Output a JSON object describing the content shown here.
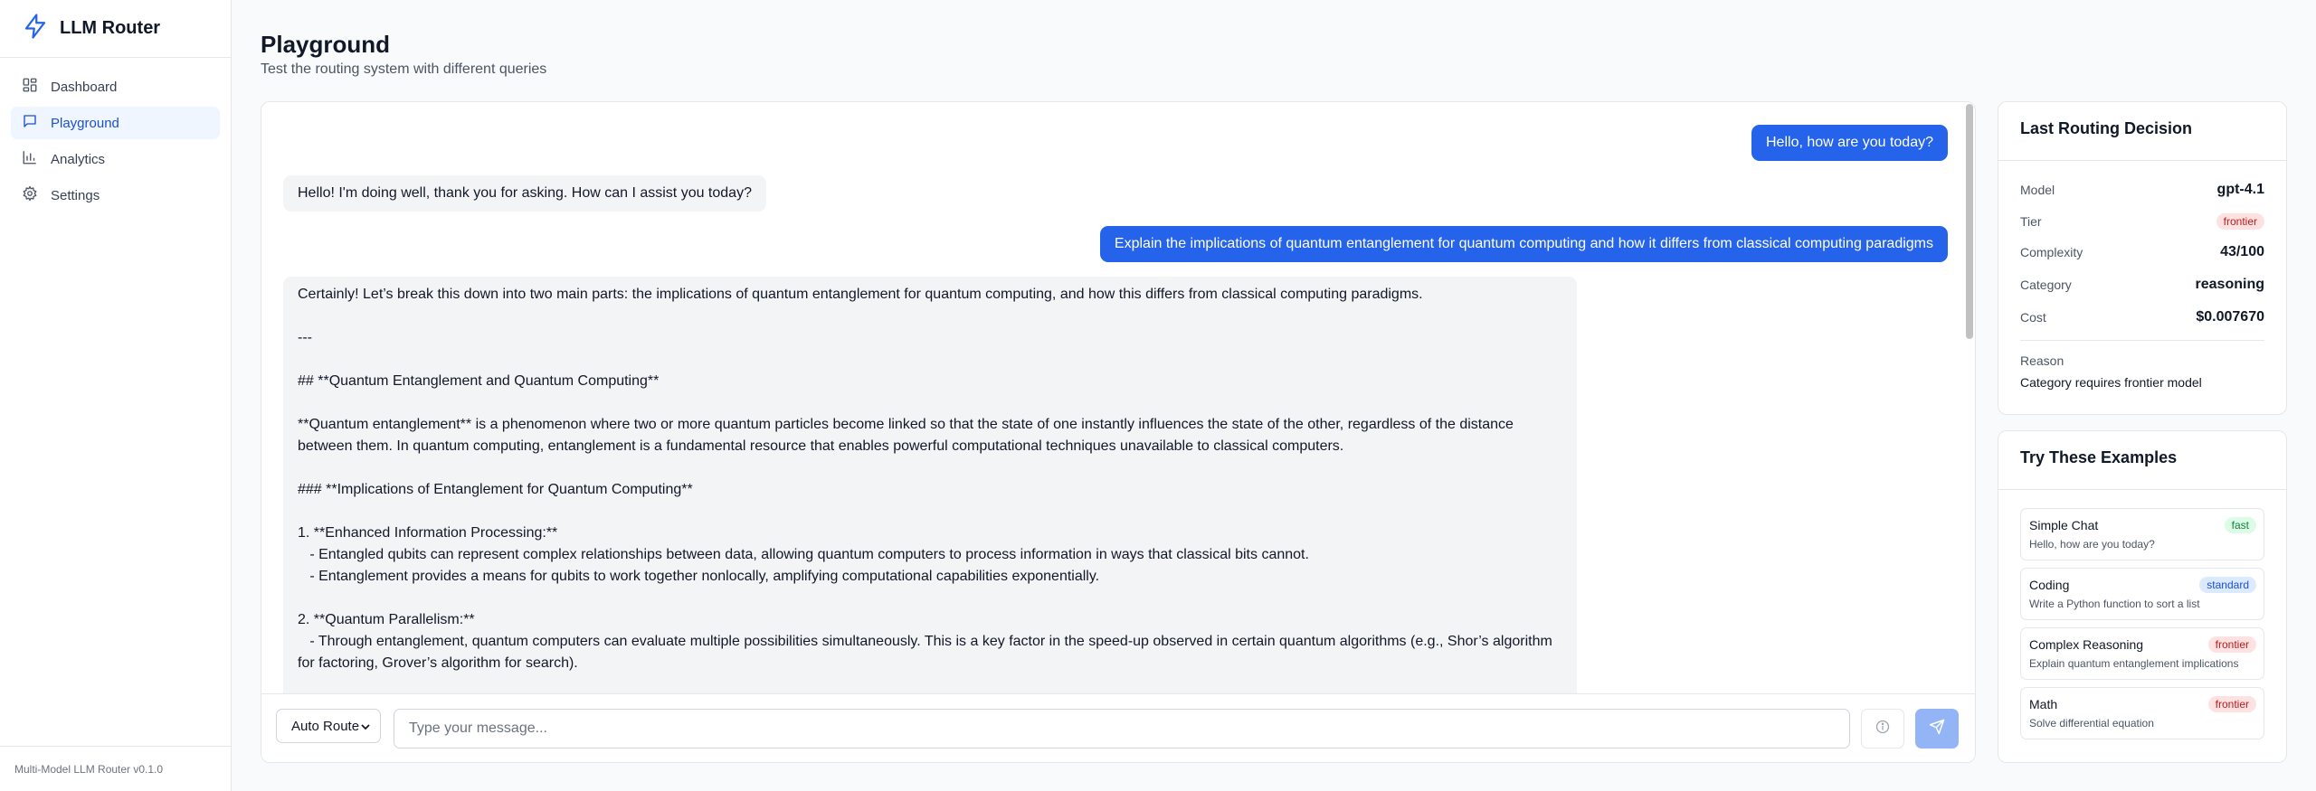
{
  "sidebar": {
    "brand": "LLM Router",
    "items": [
      {
        "label": "Dashboard",
        "icon": "dashboard-icon"
      },
      {
        "label": "Playground",
        "icon": "chat-icon",
        "active": true
      },
      {
        "label": "Analytics",
        "icon": "bar-chart-icon"
      },
      {
        "label": "Settings",
        "icon": "gear-icon"
      }
    ],
    "footer": "Multi-Model LLM Router v0.1.0"
  },
  "header": {
    "title": "Playground",
    "subtitle": "Test the routing system with different queries"
  },
  "chat": {
    "messages": [
      {
        "role": "user",
        "text": "Hello, how are you today?"
      },
      {
        "role": "assistant",
        "text": "Hello! I'm doing well, thank you for asking. How can I assist you today?"
      },
      {
        "role": "user",
        "text": "Explain the implications of quantum entanglement for quantum computing and how it differs from classical computing paradigms"
      }
    ],
    "long_answer": [
      "Certainly! Let’s break this down into two main parts: the implications of quantum entanglement for quantum computing, and how this differs from classical computing paradigms.",
      "",
      "---",
      "",
      "## **Quantum Entanglement and Quantum Computing**",
      "",
      "**Quantum entanglement** is a phenomenon where two or more quantum particles become linked so that the state of one instantly influences the state of the other, regardless of the distance between them. In quantum computing, entanglement is a fundamental resource that enables powerful computational techniques unavailable to classical computers.",
      "",
      "### **Implications of Entanglement for Quantum Computing**",
      "",
      "1. **Enhanced Information Processing:**",
      "   - Entangled qubits can represent complex relationships between data, allowing quantum computers to process information in ways that classical bits cannot.",
      "   - Entanglement provides a means for qubits to work together nonlocally, amplifying computational capabilities exponentially.",
      "",
      "2. **Quantum Parallelism:**",
      "   - Through entanglement, quantum computers can evaluate multiple possibilities simultaneously. This is a key factor in the speed-up observed in certain quantum algorithms (e.g., Shor’s algorithm for factoring, Grover’s algorithm for search)."
    ],
    "route_select": "Auto Route",
    "input_placeholder": "Type your message..."
  },
  "decision": {
    "title": "Last Routing Decision",
    "model_label": "Model",
    "model": "gpt-4.1",
    "tier_label": "Tier",
    "tier": "frontier",
    "complexity_label": "Complexity",
    "complexity": "43/100",
    "category_label": "Category",
    "category": "reasoning",
    "cost_label": "Cost",
    "cost": "$0.007670",
    "reason_label": "Reason",
    "reason": "Category requires frontier model"
  },
  "examples": {
    "title": "Try These Examples",
    "items": [
      {
        "title": "Simple Chat",
        "tier": "fast",
        "desc": "Hello, how are you today?"
      },
      {
        "title": "Coding",
        "tier": "standard",
        "desc": "Write a Python function to sort a list"
      },
      {
        "title": "Complex Reasoning",
        "tier": "frontier",
        "desc": "Explain quantum entanglement implications"
      },
      {
        "title": "Math",
        "tier": "frontier",
        "desc": "Solve differential equation"
      }
    ]
  },
  "colors": {
    "accent": "#2563eb",
    "active_bg": "#eff6ff",
    "frontier": "#b91c1c",
    "fast": "#15803d",
    "standard": "#1d4ed8"
  }
}
